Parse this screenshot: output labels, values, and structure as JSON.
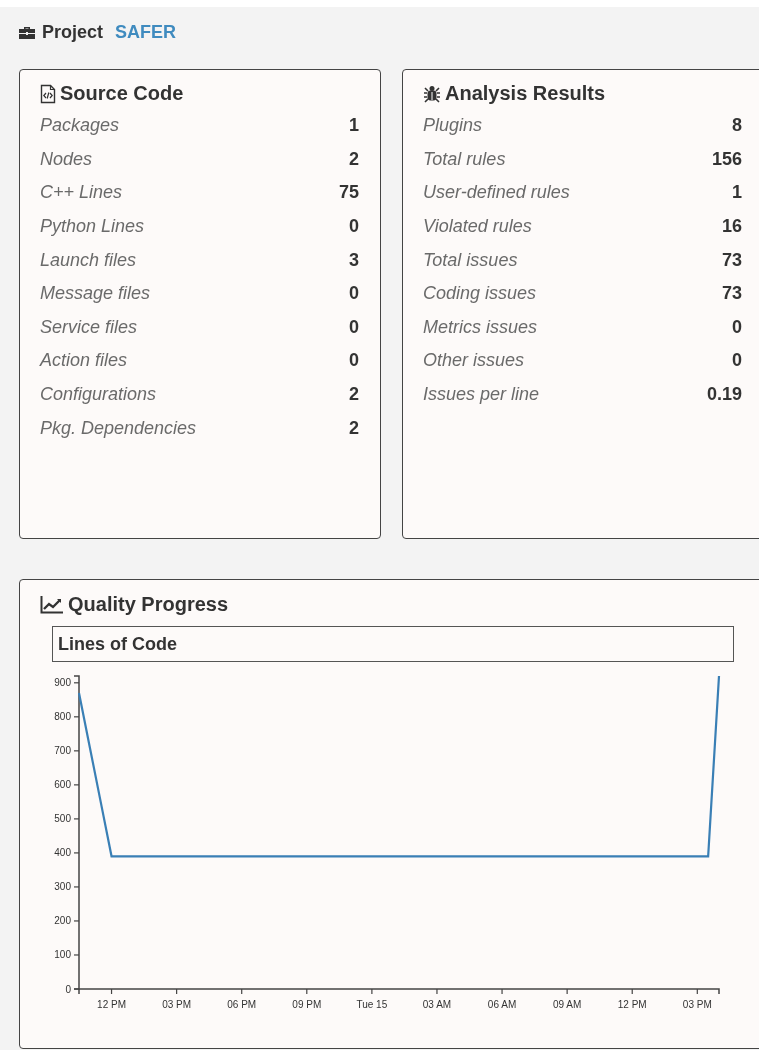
{
  "project": {
    "label": "Project",
    "name": "SAFER"
  },
  "source_code": {
    "title": "Source Code",
    "rows": [
      {
        "label": "Packages",
        "value": "1"
      },
      {
        "label": "Nodes",
        "value": "2"
      },
      {
        "label": "C++ Lines",
        "value": "75"
      },
      {
        "label": "Python Lines",
        "value": "0"
      },
      {
        "label": "Launch files",
        "value": "3"
      },
      {
        "label": "Message files",
        "value": "0"
      },
      {
        "label": "Service files",
        "value": "0"
      },
      {
        "label": "Action files",
        "value": "0"
      },
      {
        "label": "Configurations",
        "value": "2"
      },
      {
        "label": "Pkg. Dependencies",
        "value": "2"
      }
    ]
  },
  "analysis_results": {
    "title": "Analysis Results",
    "rows": [
      {
        "label": "Plugins",
        "value": "8"
      },
      {
        "label": "Total rules",
        "value": "156"
      },
      {
        "label": "User-defined rules",
        "value": "1"
      },
      {
        "label": "Violated rules",
        "value": "16"
      },
      {
        "label": "Total issues",
        "value": "73"
      },
      {
        "label": "Coding issues",
        "value": "73"
      },
      {
        "label": "Metrics issues",
        "value": "0"
      },
      {
        "label": "Other issues",
        "value": "0"
      },
      {
        "label": "Issues per line",
        "value": "0.19"
      }
    ]
  },
  "quality_progress": {
    "title": "Quality Progress",
    "chart_data": {
      "type": "line",
      "title": "Lines of Code",
      "categories": [
        null,
        null,
        null,
        "12 PM",
        null,
        null,
        null,
        null,
        null,
        "03 PM",
        null,
        null,
        null,
        null,
        null,
        "06 PM",
        null,
        null,
        null,
        null,
        null,
        "09 PM",
        null,
        null,
        null,
        null,
        null,
        "Tue 15",
        null,
        null,
        null,
        null,
        null,
        "03 AM",
        null,
        null,
        null,
        null,
        null,
        "06 AM",
        null,
        null,
        null,
        null,
        null,
        "09 AM",
        null,
        null,
        null,
        null,
        null,
        "12 PM",
        null,
        null,
        null,
        null,
        null,
        "03 PM",
        null,
        null
      ],
      "series": [
        {
          "color": "#3a7fb5",
          "values": [
            870,
            710,
            550,
            390,
            390,
            390,
            390,
            390,
            390,
            390,
            390,
            390,
            390,
            390,
            390,
            390,
            390,
            390,
            390,
            390,
            390,
            390,
            390,
            390,
            390,
            390,
            390,
            390,
            390,
            390,
            390,
            390,
            390,
            390,
            390,
            390,
            390,
            390,
            390,
            390,
            390,
            390,
            390,
            390,
            390,
            390,
            390,
            390,
            390,
            390,
            390,
            390,
            390,
            390,
            390,
            390,
            390,
            390,
            390,
            920
          ]
        }
      ],
      "ylim": [
        0,
        920
      ],
      "yticks": [
        0,
        100,
        200,
        300,
        400,
        500,
        600,
        700,
        800,
        900
      ]
    }
  }
}
